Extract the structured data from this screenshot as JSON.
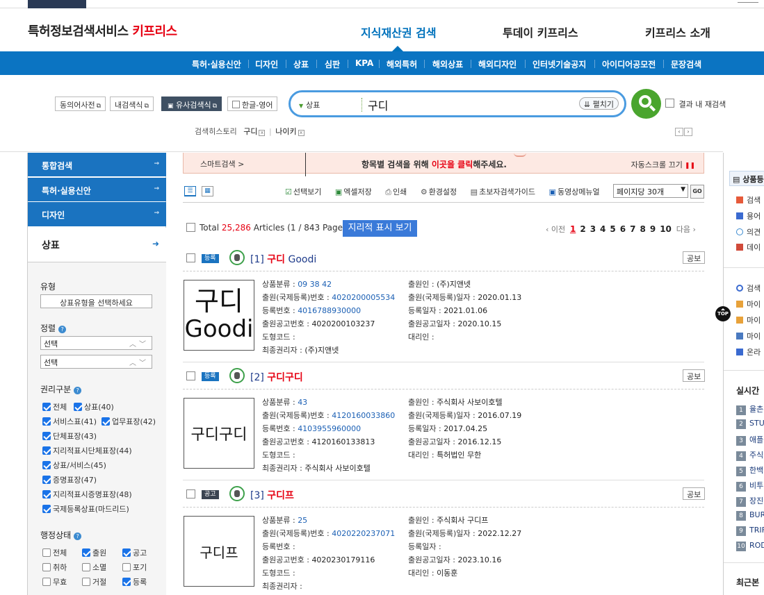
{
  "header": {
    "logo_main": "특허정보검색서비스",
    "logo_brand": "키프리스",
    "nav": [
      "지식재산권 검색",
      "투데이 키프리스",
      "키프리스 소개"
    ]
  },
  "bluebar": [
    "특허·실용신안",
    "디자인",
    "상표",
    "심판",
    "KPA",
    "해외특허",
    "해외상표",
    "해외디자인",
    "인터넷기술공지",
    "아이디어공모전",
    "문장검색"
  ],
  "search": {
    "tools": [
      "동의어사전",
      "내검색식",
      "유사검색식",
      "한글-영어"
    ],
    "category": "상표",
    "query": "구디",
    "expand_label": "펼치기",
    "recheck_label": "결과 내 재검색",
    "history_label": "검색히스토리",
    "history_terms": [
      "구디",
      "나이키"
    ]
  },
  "sidebar": {
    "items": [
      "통합검색",
      "특허·실용신안",
      "디자인"
    ],
    "active": "상표",
    "type_label": "유형",
    "type_select": "상표유형을 선택하세요",
    "sort_label": "정렬",
    "sort_1": "선택",
    "sort_2": "선택",
    "rights_label": "권리구분",
    "rights": [
      {
        "label": "전체",
        "checked": true
      },
      {
        "label": "상표(40)",
        "checked": true
      },
      {
        "label": "서비스표(41)",
        "checked": true
      },
      {
        "label": "업무표장(42)",
        "checked": true
      },
      {
        "label": "단체표장(43)",
        "checked": true
      },
      {
        "label": "지리적표시단체표장(44)",
        "checked": true
      },
      {
        "label": "상표/서비스(45)",
        "checked": true
      },
      {
        "label": "증명표장(47)",
        "checked": true
      },
      {
        "label": "지리적표시증명표장(48)",
        "checked": true
      },
      {
        "label": "국제등록상표(마드리드)",
        "checked": true
      }
    ],
    "status_label": "행정상태",
    "status": [
      {
        "label": "전체",
        "checked": false
      },
      {
        "label": "출원",
        "checked": true
      },
      {
        "label": "공고",
        "checked": true
      },
      {
        "label": "취하",
        "checked": false
      },
      {
        "label": "소멸",
        "checked": false
      },
      {
        "label": "포기",
        "checked": false
      },
      {
        "label": "무효",
        "checked": false
      },
      {
        "label": "거절",
        "checked": false
      },
      {
        "label": "등록",
        "checked": true
      }
    ]
  },
  "banner": {
    "smart": "스마트검색 >",
    "msg_pre": "항목별 검색을 위해 ",
    "msg_link": "이곳을 클릭",
    "msg_post": "해주세요.",
    "auto": "자동스크롤 끄기"
  },
  "toolbar": {
    "items": [
      "선택보기",
      "엑셀저장",
      "인쇄",
      "환경설정",
      "초보자검색가이드",
      "동영상메뉴얼"
    ],
    "perpage": "페이지당 30개",
    "go": "GO"
  },
  "summary": {
    "total_label": "Total",
    "total": "25,286",
    "articles": "Articles (1 / 843 Pages)",
    "geo_button": "지리적 표시 보기",
    "prev": "‹ 이전",
    "pages": [
      "1",
      "2",
      "3",
      "4",
      "5",
      "6",
      "7",
      "8",
      "9",
      "10"
    ],
    "next": "다음 ›"
  },
  "field_labels": {
    "class": "상품분류 :",
    "appno": "출원(국제등록)번호 :",
    "regno": "등록번호 :",
    "pubno": "출원공고번호 :",
    "figcode": "도형코드 :",
    "owner": "최종권리자 :",
    "applicant": "출원인 :",
    "appdate": "출원(국제등록)일자 :",
    "regdate": "등록일자 :",
    "pubdate": "출원공고일자 :",
    "agent": "대리인 :"
  },
  "results": [
    {
      "badge": "등록",
      "idx": "[1]",
      "name_kr": "구디",
      "name_en": "Goodi",
      "thumb_line1": "구디",
      "thumb_line2": "Goodi",
      "class": "09 38 42",
      "appno": "4020200005534",
      "regno": "4016788930000",
      "pubno": "4020200103237",
      "figcode": "",
      "owner": "(주)지앤넷",
      "applicant": "(주)지앤넷",
      "appdate": "2020.01.13",
      "regdate": "2021.01.06",
      "pubdate": "2020.10.15",
      "agent": "",
      "gongbo": "공보"
    },
    {
      "badge": "등록",
      "idx": "[2]",
      "name_kr": "구디구디",
      "name_en": "",
      "thumb_line1": "구디구디",
      "thumb_line2": "",
      "class": "43",
      "appno": "4120160033860",
      "regno": "4103955960000",
      "pubno": "4120160133813",
      "figcode": "",
      "owner": "주식회사 사보이호텔",
      "applicant": "주식회사 사보이호텔",
      "appdate": "2016.07.19",
      "regdate": "2017.04.25",
      "pubdate": "2016.12.15",
      "agent": "특허법인 무한",
      "gongbo": "공보"
    },
    {
      "badge": "공고",
      "idx": "[3]",
      "name_kr": "구디프",
      "name_en": "",
      "thumb_line1": "구디프",
      "thumb_line2": "",
      "class": "25",
      "appno": "4020220237071",
      "regno": "",
      "pubno": "4020230179116",
      "figcode": "",
      "owner": "",
      "applicant": "주식회사 구디프",
      "appdate": "2022.12.27",
      "regdate": "",
      "pubdate": "2023.10.16",
      "agent": "이동훈",
      "gongbo": "공보"
    }
  ],
  "right": {
    "tab": "상품등",
    "links1": [
      "검색",
      "용어",
      "의견",
      "데이"
    ],
    "links2": [
      "검색",
      "마이",
      "마이",
      "마이",
      "온라"
    ],
    "top_label": "TOP",
    "realtime_label": "실시간",
    "ranks": [
      "율촌",
      "STU",
      "애플",
      "주식",
      "한백",
      "비투",
      "장진",
      "BUR",
      "TRIF",
      "ROD"
    ],
    "recent_label": "최근본"
  },
  "colors": {
    "brand_red": "#e60012",
    "nav_blue": "#0b74c2",
    "search_green": "#4aa52e"
  }
}
